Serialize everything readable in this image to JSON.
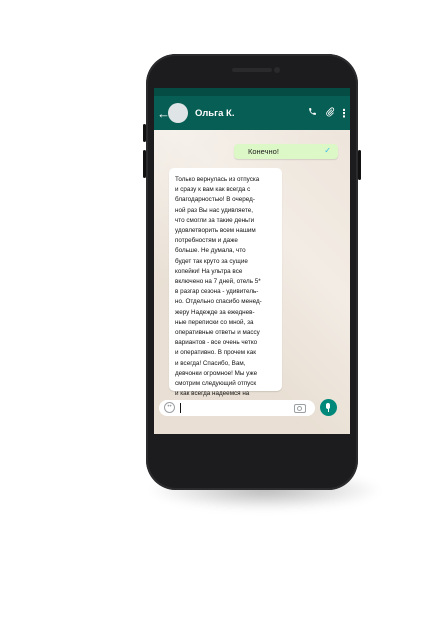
{
  "chat": {
    "back_icon": "arrow-left-icon",
    "contact_name": "Ольга К.",
    "icons": [
      "phone-icon",
      "paperclip-icon",
      "more-vertical-icon"
    ]
  },
  "messages": {
    "outgoing": {
      "text": "Конечно!",
      "status_icon": "check-icon"
    },
    "incoming": {
      "text": "Только вернулась из отпуска\nи сразу к вам как всегда с\nблагодарностью! В очеред-\nной раз Вы нас удивляете,\nчто смогли за такие деньги\nудовлетворить всем нашим\nпотребностям и даже\nбольше.  Не думала, что\nбудет так круто за сущие\nкопейки! На ультра все\nвключено на 7 дней, отель 5*\nв разгар сезона - удивитель-\nно. Отдельно спасибо менед-\nжеру Надежде за ежеднев-\nные переписки со мной, за\nоперативные ответы и массу\nвариантов - все очень четко\nи оперативно. В прочем как\nи всегда! Спасибо, Вам,\nдевчонки огромное! Мы уже\nсмотрим следующий отпуск\nи как всегда надеемся на\nвас!!!"
    }
  },
  "composer": {
    "value": "",
    "icons": [
      "emoji-icon",
      "camera-icon",
      "mic-icon"
    ]
  },
  "colors": {
    "header": "#075e54",
    "outgoing_bubble": "#dcf8c6",
    "incoming_bubble": "#ffffff",
    "mic_button": "#00897b",
    "phone_body": "#1c1c1e"
  }
}
